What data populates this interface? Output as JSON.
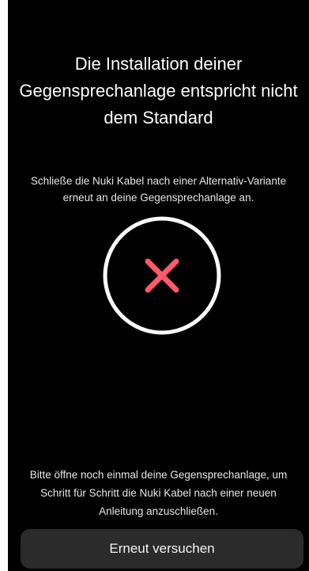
{
  "title": {
    "line1": "Die Installation deiner",
    "line2": "Gegensprechanlage entspricht nicht",
    "line3": "dem Standard"
  },
  "subtitle": {
    "line1": "Schließe die Nuki Kabel nach einer Alternativ-Variante",
    "line2": "erneut an deine Gegensprechanlage an."
  },
  "status_icon": {
    "name": "error-x-icon",
    "ring_color": "#ffffff",
    "x_color": "#ff5a6a"
  },
  "instructions": {
    "line1": "Bitte öffne noch einmal deine Gegensprechanlage, um",
    "line2": "Schritt für Schritt die Nuki Kabel nach einer neuen",
    "line3": "Anleitung anzuschließen."
  },
  "button": {
    "label": "Erneut versuchen"
  },
  "colors": {
    "background": "#000000",
    "button_background": "#2b2b2b",
    "text": "#ffffff"
  }
}
